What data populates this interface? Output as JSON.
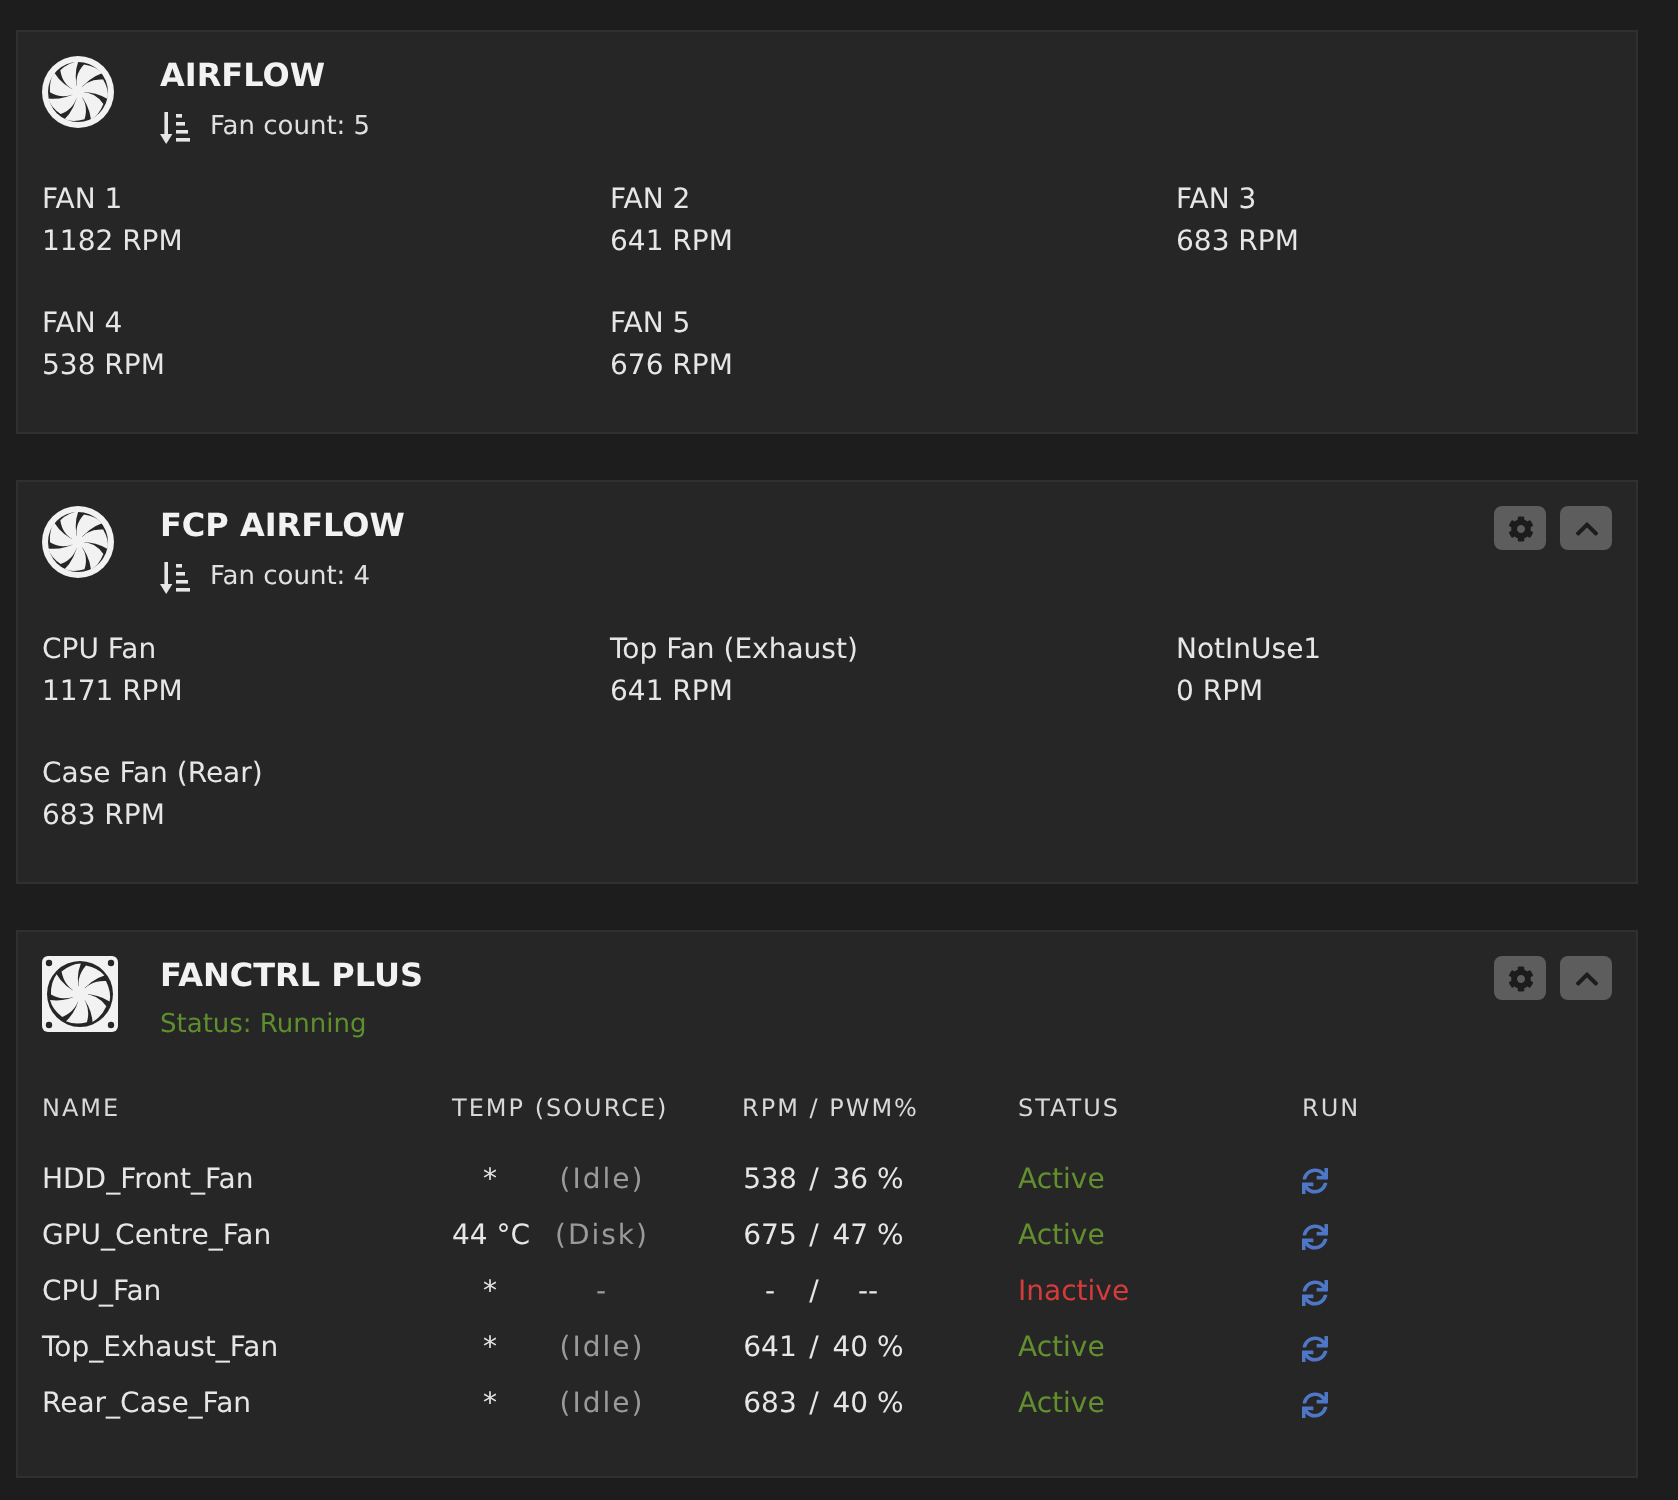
{
  "panels": [
    {
      "kind": "fan_grid",
      "title": "AIRFLOW",
      "subtitle": "Fan count: 5",
      "fans": [
        {
          "name": "FAN 1",
          "rpm": "1182 RPM"
        },
        {
          "name": "FAN 2",
          "rpm": "641 RPM"
        },
        {
          "name": "FAN 3",
          "rpm": "683 RPM"
        },
        {
          "name": "FAN 4",
          "rpm": "538 RPM"
        },
        {
          "name": "FAN 5",
          "rpm": "676 RPM"
        }
      ]
    },
    {
      "kind": "fan_grid",
      "title": "FCP AIRFLOW",
      "subtitle": "Fan count: 4",
      "header_buttons": [
        {
          "kind": "settings"
        },
        {
          "kind": "collapse"
        }
      ],
      "fans": [
        {
          "name": "CPU Fan",
          "rpm": "1171 RPM"
        },
        {
          "name": "Top Fan (Exhaust)",
          "rpm": "641 RPM"
        },
        {
          "name": "NotInUse1",
          "rpm": "0 RPM"
        },
        {
          "name": "Case Fan (Rear)",
          "rpm": "683 RPM"
        }
      ]
    },
    {
      "kind": "fan_table",
      "title": "FANCTRL PLUS",
      "status": "Status: Running",
      "running": true,
      "header_buttons": [
        {
          "kind": "settings"
        },
        {
          "kind": "collapse"
        }
      ],
      "columns": [
        "NAME",
        "TEMP (SOURCE)",
        "RPM / PWM%",
        "STATUS",
        "RUN"
      ],
      "rows": [
        {
          "name": "HDD_Front_Fan",
          "temp": "*",
          "source": "(Idle)",
          "rpm_pwm": [
            "538",
            "/",
            "36 %"
          ],
          "status": "Active",
          "active": true
        },
        {
          "name": "GPU_Centre_Fan",
          "temp": "44 °C",
          "source": "(Disk)",
          "rpm_pwm": [
            "675",
            "/",
            "47 %"
          ],
          "status": "Active",
          "active": true
        },
        {
          "name": "CPU_Fan",
          "temp": "*",
          "source": "-",
          "rpm_pwm": [
            "-",
            "/",
            "--"
          ],
          "status": "Inactive",
          "active": false
        },
        {
          "name": "Top_Exhaust_Fan",
          "temp": "*",
          "source": "(Idle)",
          "rpm_pwm": [
            "641",
            "/",
            "40 %"
          ],
          "status": "Active",
          "active": true
        },
        {
          "name": "Rear_Case_Fan",
          "temp": "*",
          "source": "(Idle)",
          "rpm_pwm": [
            "683",
            "/",
            "40 %"
          ],
          "status": "Active",
          "active": true
        }
      ]
    }
  ]
}
